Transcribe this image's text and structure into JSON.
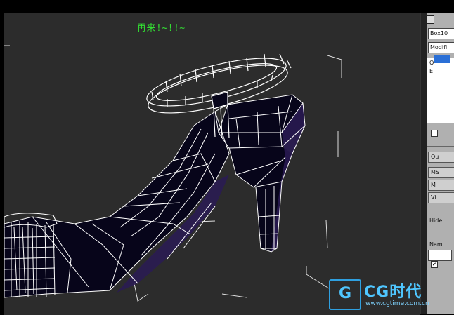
{
  "viewport": {
    "annotation": "再来!~!!~"
  },
  "command_panel": {
    "object_name": "Box10",
    "modifier_list": "Modifi",
    "stack_items": [
      "Q",
      "E"
    ],
    "buttons": [
      "Qu",
      "MS",
      "M",
      "Vi"
    ],
    "hide_label": "Hide",
    "name_label": "Nam",
    "checkbox_checked": "✔"
  },
  "watermark": {
    "brand": "CG时代",
    "logo_letter": "G",
    "url": "www.cgtime.com.cn"
  }
}
